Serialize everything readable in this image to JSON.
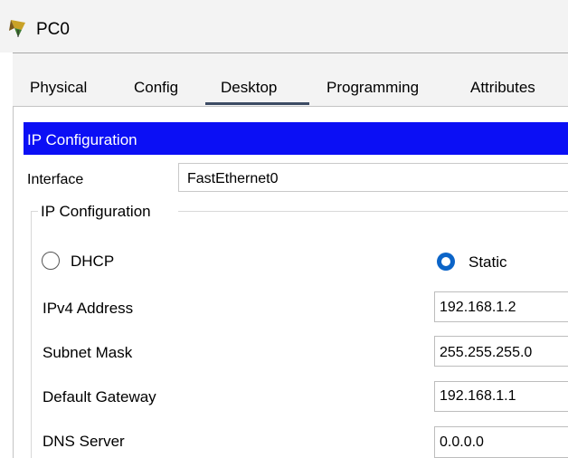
{
  "window": {
    "title": "PC0",
    "icon": "pc-device-icon"
  },
  "tabs": [
    {
      "label": "Physical",
      "active": false
    },
    {
      "label": "Config",
      "active": false
    },
    {
      "label": "Desktop",
      "active": true
    },
    {
      "label": "Programming",
      "active": false
    },
    {
      "label": "Attributes",
      "active": false
    }
  ],
  "ip_config": {
    "header": "IP Configuration",
    "header_color": "#0b0ff5",
    "interface_label": "Interface",
    "interface_value": "FastEthernet0",
    "group_title": "IP Configuration",
    "mode": {
      "dhcp_label": "DHCP",
      "static_label": "Static",
      "selected": "Static"
    },
    "fields": {
      "ipv4_label": "IPv4 Address",
      "ipv4_value": "192.168.1.2",
      "subnet_label": "Subnet Mask",
      "subnet_value": "255.255.255.0",
      "gateway_label": "Default Gateway",
      "gateway_value": "192.168.1.1",
      "dns_label": "DNS Server",
      "dns_value": "0.0.0.0"
    }
  }
}
